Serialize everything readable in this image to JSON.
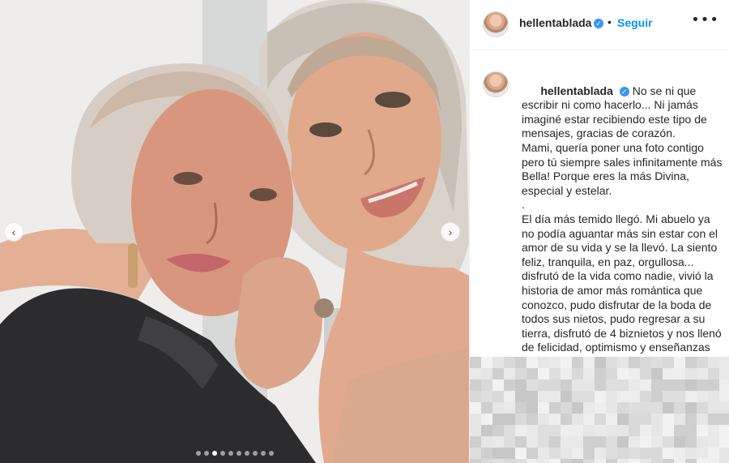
{
  "post": {
    "username": "hellentablada",
    "follow_label": "Seguir",
    "separator": "•",
    "more_label": "•••",
    "verified_glyph": "✓",
    "caption_paragraphs": [
      "No se ni que escribir ni como hacerlo... Ni jamás imaginé estar recibiendo este tipo de mensajes, gracias de corazón.\nMami, quería poner una foto contigo pero tú siempre sales infinitamente más Bella! Porque eres la más Divina, especial y estelar.\n.\nEl día más temido llegó. Mi abuelo ya no podía aguantar más sin estar con el amor de su vida y se la llevó. La siento feliz, tranquila, en paz, orgullosa... disfrutó de la vida como nadie, vivió la historia de amor más romántica que conozco, pudo disfrutar de la boda de todos sus nietos, pudo regresar a su tierra, disfrutó de 4 biznietos y nos llenó de felicidad, optimismo y enseñanzas cada minuto de nuestras"
    ]
  },
  "carousel": {
    "prev_label": "‹",
    "next_label": "›",
    "slide_count": 10,
    "active_slide": 3
  },
  "colors": {
    "accent": "#0095f6",
    "verified": "#3897f0",
    "text": "#262626",
    "border": "#efefef"
  },
  "icons": {
    "header_avatar": "profile-avatar-icon",
    "verified": "verified-badge-icon",
    "more": "more-options-icon",
    "prev": "chevron-left-icon",
    "next": "chevron-right-icon"
  }
}
